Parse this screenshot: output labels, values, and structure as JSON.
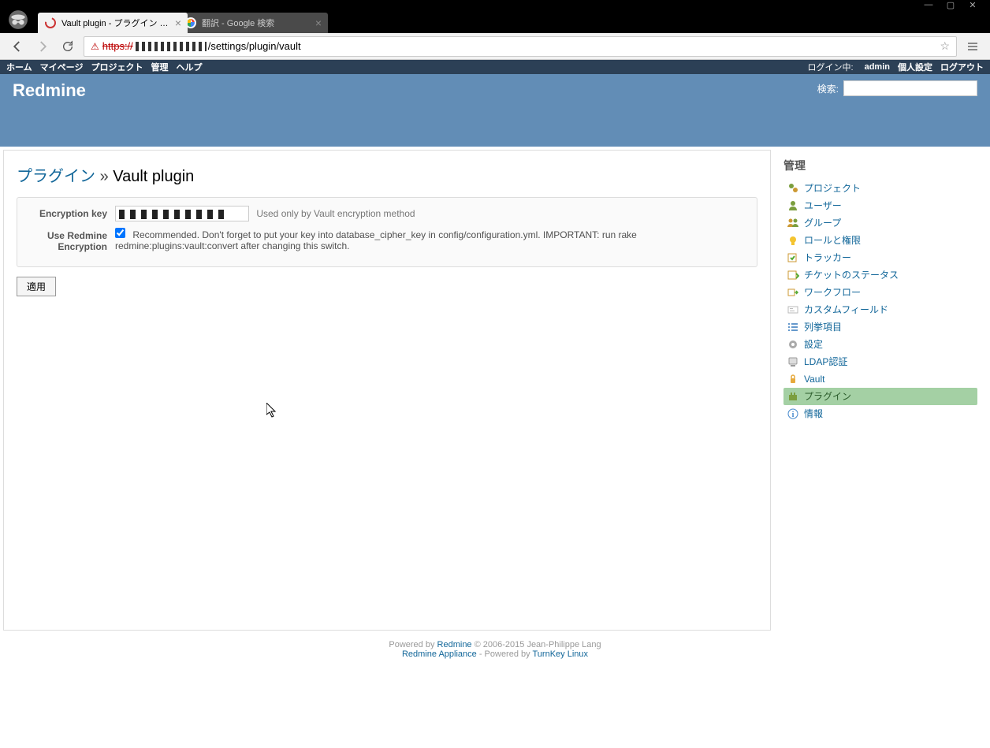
{
  "window": {
    "tabs": [
      {
        "title": "Vault plugin - プラグイン - R",
        "active": true
      },
      {
        "title": "翻訳 - Google 検索",
        "active": false
      }
    ],
    "url_prefix": "https://",
    "url_path": "/settings/plugin/vault"
  },
  "top_menu": {
    "left": [
      "ホーム",
      "マイページ",
      "プロジェクト",
      "管理",
      "ヘルプ"
    ],
    "login_label": "ログイン中:",
    "login_user": "admin",
    "right": [
      "個人設定",
      "ログアウト"
    ]
  },
  "header": {
    "title": "Redmine",
    "search_label": "検索:",
    "search_value": ""
  },
  "content": {
    "breadcrumb_link": "プラグイン",
    "breadcrumb_sep": "»",
    "page_title": "Vault plugin",
    "fields": {
      "encryption_key": {
        "label": "Encryption key",
        "hint": "Used only by Vault encryption method"
      },
      "use_redmine_encryption": {
        "label": "Use Redmine Encryption",
        "checked": true,
        "hint": "Recommended. Don't forget to put your key into database_cipher_key in config/configuration.yml. IMPORTANT: run rake redmine:plugins:vault:convert after changing this switch."
      }
    },
    "submit_label": "適用"
  },
  "sidebar": {
    "title": "管理",
    "items": [
      {
        "label": "プロジェクト",
        "icon": "projects",
        "selected": false
      },
      {
        "label": "ユーザー",
        "icon": "user",
        "selected": false
      },
      {
        "label": "グループ",
        "icon": "group",
        "selected": false
      },
      {
        "label": "ロールと権限",
        "icon": "roles",
        "selected": false
      },
      {
        "label": "トラッカー",
        "icon": "tracker",
        "selected": false
      },
      {
        "label": "チケットのステータス",
        "icon": "status",
        "selected": false
      },
      {
        "label": "ワークフロー",
        "icon": "workflow",
        "selected": false
      },
      {
        "label": "カスタムフィールド",
        "icon": "custom",
        "selected": false
      },
      {
        "label": "列挙項目",
        "icon": "enum",
        "selected": false
      },
      {
        "label": "設定",
        "icon": "settings",
        "selected": false
      },
      {
        "label": "LDAP認証",
        "icon": "ldap",
        "selected": false
      },
      {
        "label": "Vault",
        "icon": "vault",
        "selected": false
      },
      {
        "label": "プラグイン",
        "icon": "plugins",
        "selected": true
      },
      {
        "label": "情報",
        "icon": "info",
        "selected": false
      }
    ]
  },
  "footer": {
    "powered_by": "Powered by ",
    "redmine": "Redmine",
    "copyright": " © 2006-2015 Jean-Philippe Lang",
    "appliance": "Redmine Appliance",
    "appliance_mid": " - Powered by ",
    "turnkey": "TurnKey Linux"
  }
}
